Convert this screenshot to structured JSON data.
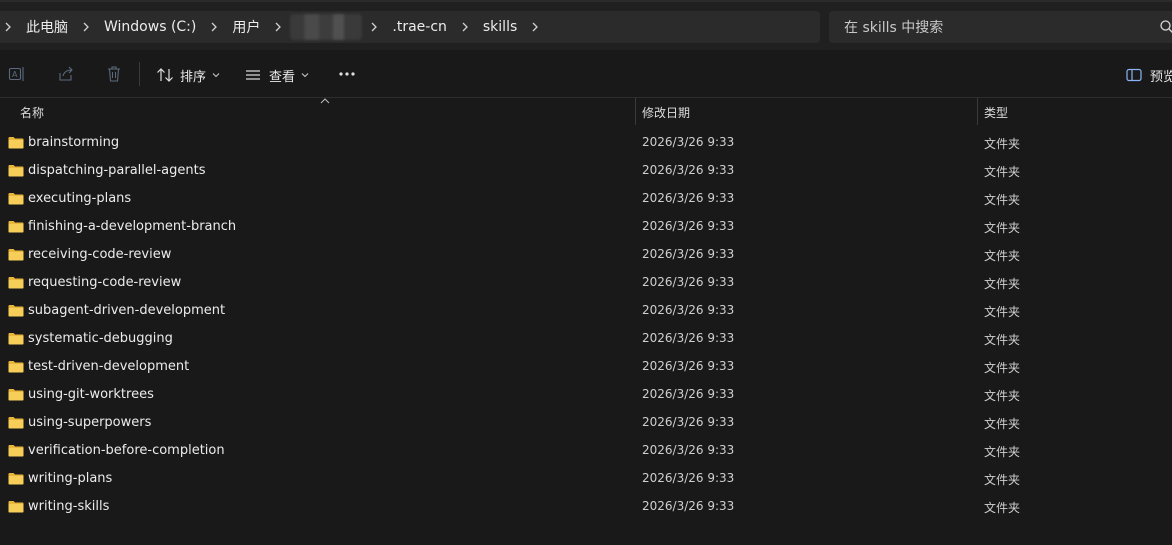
{
  "breadcrumb": {
    "items": [
      "此电脑",
      "Windows (C:)",
      "用户",
      ".trae-cn",
      "skills"
    ]
  },
  "search": {
    "placeholder": "在 skills 中搜索"
  },
  "toolbar": {
    "sort_label": "排序",
    "view_label": "查看",
    "preview_label": "预览"
  },
  "columns": {
    "name": "名称",
    "modified": "修改日期",
    "type": "类型"
  },
  "files": [
    {
      "name": "brainstorming",
      "modified": "2026/3/26 9:33",
      "type": "文件夹"
    },
    {
      "name": "dispatching-parallel-agents",
      "modified": "2026/3/26 9:33",
      "type": "文件夹"
    },
    {
      "name": "executing-plans",
      "modified": "2026/3/26 9:33",
      "type": "文件夹"
    },
    {
      "name": "finishing-a-development-branch",
      "modified": "2026/3/26 9:33",
      "type": "文件夹"
    },
    {
      "name": "receiving-code-review",
      "modified": "2026/3/26 9:33",
      "type": "文件夹"
    },
    {
      "name": "requesting-code-review",
      "modified": "2026/3/26 9:33",
      "type": "文件夹"
    },
    {
      "name": "subagent-driven-development",
      "modified": "2026/3/26 9:33",
      "type": "文件夹"
    },
    {
      "name": "systematic-debugging",
      "modified": "2026/3/26 9:33",
      "type": "文件夹"
    },
    {
      "name": "test-driven-development",
      "modified": "2026/3/26 9:33",
      "type": "文件夹"
    },
    {
      "name": "using-git-worktrees",
      "modified": "2026/3/26 9:33",
      "type": "文件夹"
    },
    {
      "name": "using-superpowers",
      "modified": "2026/3/26 9:33",
      "type": "文件夹"
    },
    {
      "name": "verification-before-completion",
      "modified": "2026/3/26 9:33",
      "type": "文件夹"
    },
    {
      "name": "writing-plans",
      "modified": "2026/3/26 9:33",
      "type": "文件夹"
    },
    {
      "name": "writing-skills",
      "modified": "2026/3/26 9:33",
      "type": "文件夹"
    }
  ],
  "icons": {
    "folder": "folder-icon",
    "rename": "rename-icon",
    "share": "share-icon",
    "delete": "delete-icon",
    "sort": "sort-icon",
    "view": "view-icon",
    "more": "more-icon",
    "preview": "preview-pane-icon",
    "search": "search-icon"
  },
  "colors": {
    "background": "#191919",
    "addressbar": "#2b2b2b",
    "folder": "#f4c542",
    "text": "#ececec"
  }
}
